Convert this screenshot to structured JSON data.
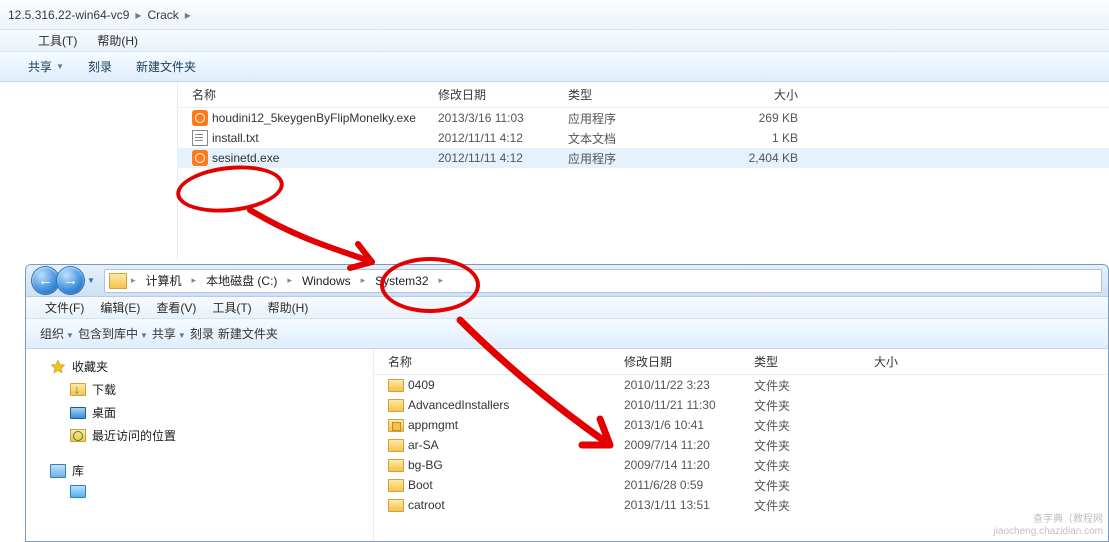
{
  "top": {
    "address": {
      "partial": "12.5.316.22-win64-vc9",
      "current": "Crack"
    },
    "menus": {
      "tools": "工具(T)",
      "help": "帮助(H)"
    },
    "cmd": {
      "share": "共享",
      "burn": "刻录",
      "newfolder": "新建文件夹"
    },
    "cols": {
      "name": "名称",
      "mdate": "修改日期",
      "type": "类型",
      "size": "大小"
    },
    "rows": [
      {
        "name": "houdini12_5keygenByFlipMonelky.exe",
        "date": "2013/3/16 11:03",
        "type": "应用程序",
        "size": "269 KB",
        "icon": "orange"
      },
      {
        "name": "install.txt",
        "date": "2012/11/11 4:12",
        "type": "文本文档",
        "size": "1 KB",
        "icon": "txt"
      },
      {
        "name": "sesinetd.exe",
        "date": "2012/11/11 4:12",
        "type": "应用程序",
        "size": "2,404 KB",
        "icon": "orange",
        "sel": true
      }
    ]
  },
  "bot": {
    "crumbs": {
      "computer": "计算机",
      "disk": "本地磁盘 (C:)",
      "windows": "Windows",
      "sys32": "System32"
    },
    "menus": {
      "file": "文件(F)",
      "edit": "编辑(E)",
      "view": "查看(V)",
      "tools": "工具(T)",
      "help": "帮助(H)"
    },
    "cmd": {
      "organize": "组织",
      "include": "包含到库中",
      "share": "共享",
      "burn": "刻录",
      "newfolder": "新建文件夹"
    },
    "nav": {
      "favorites": "收藏夹",
      "downloads": "下载",
      "desktop": "桌面",
      "recent": "最近访问的位置",
      "library": "库"
    },
    "cols": {
      "name": "名称",
      "mdate": "修改日期",
      "type": "类型",
      "size": "大小"
    },
    "rows": [
      {
        "name": "0409",
        "date": "2010/11/22 3:23",
        "type": "文件夹",
        "icon": "folder"
      },
      {
        "name": "AdvancedInstallers",
        "date": "2010/11/21 11:30",
        "type": "文件夹",
        "icon": "folder"
      },
      {
        "name": "appmgmt",
        "date": "2013/1/6 10:41",
        "type": "文件夹",
        "icon": "lock"
      },
      {
        "name": "ar-SA",
        "date": "2009/7/14 11:20",
        "type": "文件夹",
        "icon": "folder"
      },
      {
        "name": "bg-BG",
        "date": "2009/7/14 11:20",
        "type": "文件夹",
        "icon": "folder"
      },
      {
        "name": "Boot",
        "date": "2011/6/28 0:59",
        "type": "文件夹",
        "icon": "folder"
      },
      {
        "name": "catroot",
        "date": "2013/1/11 13:51",
        "type": "文件夹",
        "icon": "folder"
      }
    ]
  },
  "watermark": {
    "l1": "查字典〔教程网",
    "l2": "jiaocheng.chazidian.com"
  }
}
